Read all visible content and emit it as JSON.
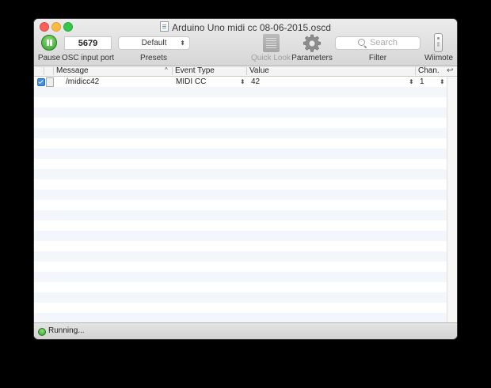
{
  "window": {
    "title": "Arduino Uno midi cc 08-06-2015.oscd"
  },
  "toolbar": {
    "pause_label": "Pause",
    "osc_port_value": "5679",
    "osc_port_label": "OSC input port",
    "preset_value": "Default",
    "presets_label": "Presets",
    "quicklook_label": "Quick Look",
    "parameters_label": "Parameters",
    "search_placeholder": "Search",
    "filter_label": "Filter",
    "wiimote_label": "Wiimote"
  },
  "table": {
    "columns": {
      "message": "Message",
      "event_type": "Event Type",
      "value": "Value",
      "channel": "Chan."
    },
    "rows": [
      {
        "enabled": true,
        "message": "/midicc42",
        "event_type": "MIDI CC",
        "value": "42",
        "channel": "1"
      }
    ]
  },
  "status": {
    "text": "Running..."
  },
  "colors": {
    "status_running": "#34c84a",
    "checkbox_accent": "#3d8fe6",
    "row_stripe": "#f3f6fa"
  },
  "icons": {
    "pause": "pause-icon",
    "quicklook": "quick-look-icon",
    "parameters": "gear-icon",
    "search": "search-icon",
    "wiimote": "wiimote-icon",
    "status": "status-indicator-icon"
  }
}
